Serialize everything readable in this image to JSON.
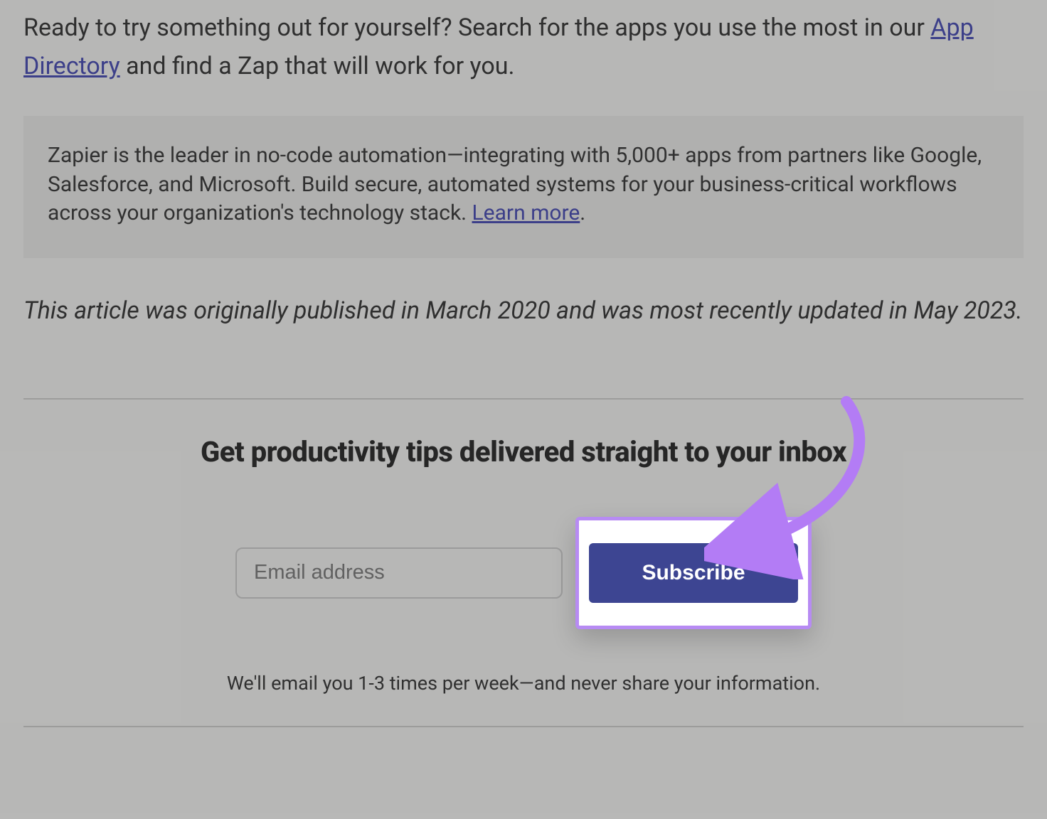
{
  "intro": {
    "before_link": "Ready to try something out for yourself? Search for the apps you use the most in our ",
    "link_text": "App Directory",
    "after_link": " and find a Zap that will work for you."
  },
  "callout": {
    "body_before_link": "Zapier is the leader in no-code automation—integrating with 5,000+ apps from partners like Google, Salesforce, and Microsoft. Build secure, automated systems for your business-critical workflows across your organization's technology stack. ",
    "link_text": "Learn more",
    "body_after_link": "."
  },
  "meta_note": "This article was originally published in March 2020 and was most recently updated in May 2023.",
  "signup": {
    "heading": "Get productivity tips delivered straight to your inbox",
    "email_placeholder": "Email address",
    "subscribe_label": "Subscribe",
    "disclaimer": "We'll email you 1-3 times per week—and never share your information."
  },
  "colors": {
    "link": "#4a4da8",
    "button_bg": "#3d4592",
    "highlight_border": "#b78bf3",
    "arrow": "#b37cf5"
  }
}
